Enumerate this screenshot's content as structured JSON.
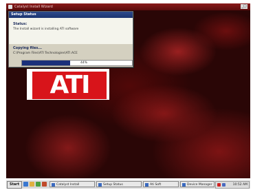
{
  "window": {
    "title": "Catalyst Install Wizard",
    "control_label": "_□"
  },
  "dialog": {
    "title": "Setup Status",
    "status_label": "Status:",
    "status_text": "The Install wizard is installing ATI software",
    "file_label": "Copying files...",
    "file_text": "C:\\Program Files\\ATI Technologies\\ATI.ACE",
    "progress_fraction": 0.44,
    "progress_text": "44%"
  },
  "logo": {
    "text": "ATI",
    "color": "#d8141a"
  },
  "taskbar": {
    "start_label": "Start",
    "quick_launch": [
      "ie-icon",
      "desktop-icon",
      "media-icon",
      "explorer-icon"
    ],
    "tasks": [
      {
        "label": "Catalyst Install"
      },
      {
        "label": "Setup Status"
      },
      {
        "label": "Ati Soft"
      },
      {
        "label": "Device Manager"
      }
    ],
    "clock": "10:52 AM"
  },
  "colors": {
    "desktop_red": "#8a1a1a",
    "progress_blue": "#1a2f7a"
  }
}
